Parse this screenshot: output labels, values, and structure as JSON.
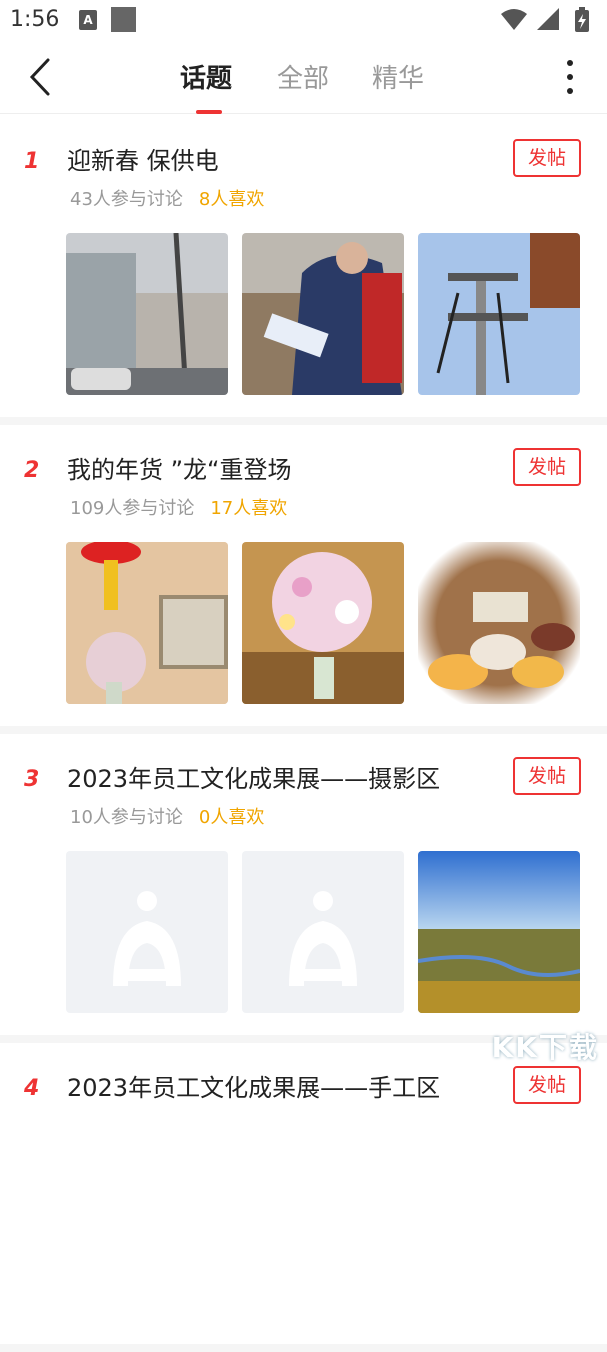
{
  "status_bar": {
    "time": "1:56",
    "a_icon": "A"
  },
  "nav": {
    "tabs": [
      {
        "label": "话题",
        "active": true
      },
      {
        "label": "全部",
        "active": false
      },
      {
        "label": "精华",
        "active": false
      }
    ]
  },
  "topics": [
    {
      "rank": "1",
      "title": "迎新春 保供电",
      "discuss": "43人参与讨论",
      "likes": "8人喜欢",
      "post_label": "发帖"
    },
    {
      "rank": "2",
      "title": "我的年货 ”龙“重登场",
      "discuss": "109人参与讨论",
      "likes": "17人喜欢",
      "post_label": "发帖"
    },
    {
      "rank": "3",
      "title": "2023年员工文化成果展——摄影区",
      "discuss": "10人参与讨论",
      "likes": "0人喜欢",
      "post_label": "发帖"
    },
    {
      "rank": "4",
      "title": "2023年员工文化成果展——手工区",
      "post_label": "发帖"
    }
  ],
  "watermark": "KK下载",
  "colors": {
    "accent": "#e33333",
    "like": "#f0a500"
  }
}
